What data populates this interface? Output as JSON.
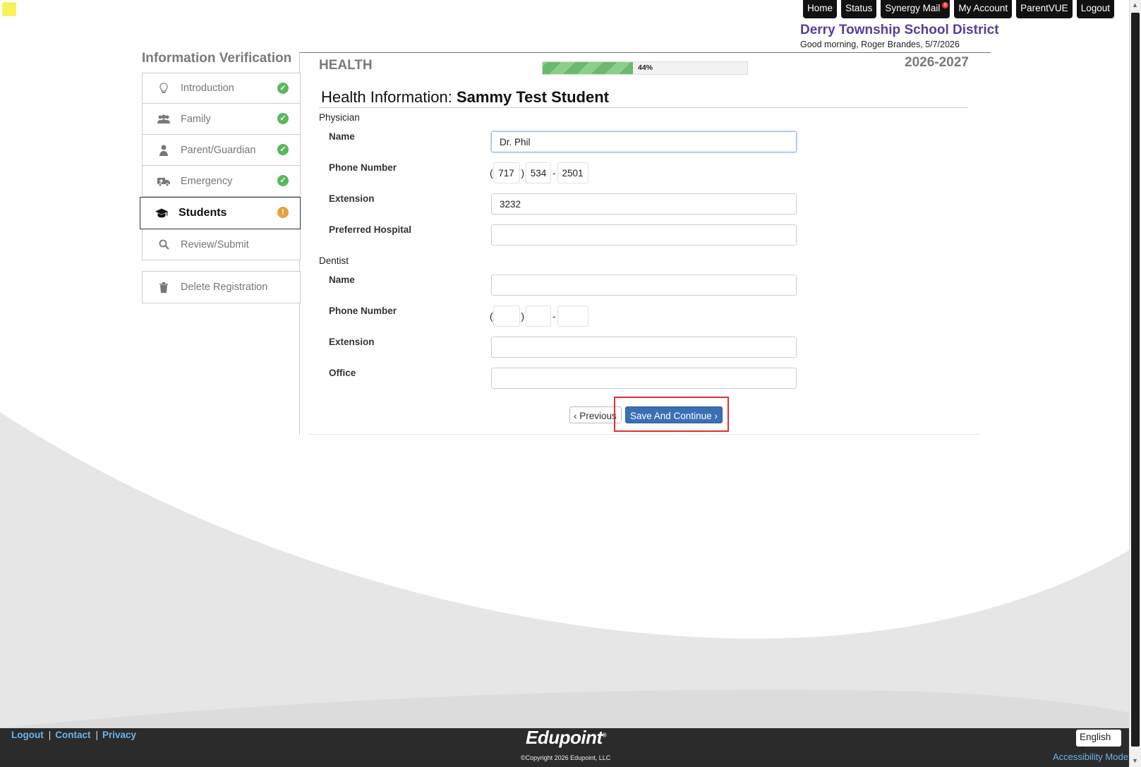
{
  "topnav": {
    "home": "Home",
    "status": "Status",
    "synergy_mail": "Synergy Mail",
    "mail_count": "0",
    "my_account": "My Account",
    "parentvue": "ParentVUE",
    "logout": "Logout"
  },
  "header": {
    "district": "Derry Township School District",
    "greeting": "Good morning, Roger Brandes, 5/7/2026"
  },
  "sidebar": {
    "title": "Information Verification",
    "items": [
      {
        "label": "Introduction",
        "icon": "lightbulb-icon",
        "status": "complete"
      },
      {
        "label": "Family",
        "icon": "users-icon",
        "status": "complete"
      },
      {
        "label": "Parent/Guardian",
        "icon": "user-icon",
        "status": "complete"
      },
      {
        "label": "Emergency",
        "icon": "ambulance-icon",
        "status": "complete"
      },
      {
        "label": "Students",
        "icon": "graduation-cap-icon",
        "status": "attention",
        "active": true
      },
      {
        "label": "Review/Submit",
        "icon": "search-icon"
      }
    ],
    "delete_label": "Delete Registration"
  },
  "main": {
    "section": "HEALTH",
    "progress_value": 0.44,
    "progress_label": "44%",
    "year": "2026-2027",
    "title_prefix": "Health Information: ",
    "title_name": "Sammy Test Student"
  },
  "physician": {
    "group_label": "Physician",
    "name_label": "Name",
    "name_value": "Dr. Phil",
    "phone_label": "Phone Number",
    "phone_area": "717",
    "phone_prefix": "534",
    "phone_line": "2501",
    "extension_label": "Extension",
    "extension_value": "3232",
    "hospital_label": "Preferred Hospital",
    "hospital_value": ""
  },
  "dentist": {
    "group_label": "Dentist",
    "name_label": "Name",
    "name_value": "",
    "phone_label": "Phone Number",
    "phone_area": "",
    "phone_prefix": "",
    "phone_line": "",
    "extension_label": "Extension",
    "extension_value": "",
    "office_label": "Office",
    "office_value": ""
  },
  "phone_symbols": {
    "open": "(",
    "close": ")",
    "dash": "-"
  },
  "buttons": {
    "previous": "Previous",
    "save_continue": "Save And Continue"
  },
  "footer": {
    "logout": "Logout",
    "contact": "Contact",
    "privacy": "Privacy",
    "pipe": "|",
    "logo": "Edupoint",
    "copyright": "©Copyright 2026 Edupoint, LLC",
    "language": "English",
    "accessibility": "Accessibility Mode"
  },
  "colors": {
    "district": "#5a3c9b",
    "primary_button": "#3a6fb5",
    "complete": "#5cb85c",
    "attention": "#e6a23c",
    "highlight": "#e03030"
  }
}
